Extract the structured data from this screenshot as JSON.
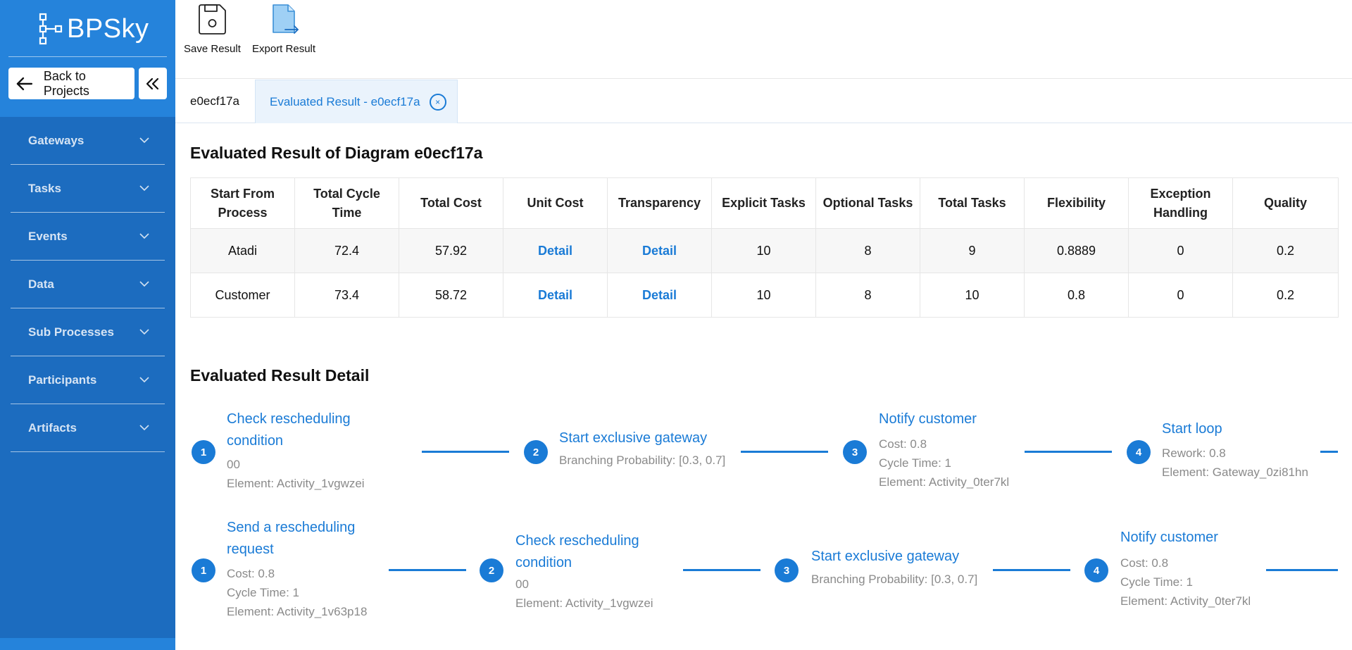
{
  "app": {
    "name": "BPSky"
  },
  "sidebar": {
    "back_label": "Back to Projects",
    "items": [
      {
        "label": "Gateways"
      },
      {
        "label": "Tasks"
      },
      {
        "label": "Events"
      },
      {
        "label": "Data"
      },
      {
        "label": "Sub Processes"
      },
      {
        "label": "Participants"
      },
      {
        "label": "Artifacts"
      }
    ]
  },
  "toolbar": {
    "save_label": "Save Result",
    "export_label": "Export Result"
  },
  "tabs": [
    {
      "label": "e0ecf17a",
      "active": false
    },
    {
      "label": "Evaluated Result - e0ecf17a",
      "active": true,
      "close": "×"
    }
  ],
  "main": {
    "title": "Evaluated Result of Diagram e0ecf17a",
    "detail_title": "Evaluated Result Detail"
  },
  "table": {
    "headers": [
      "Start From Process",
      "Total Cycle Time",
      "Total Cost",
      "Unit Cost",
      "Transparency",
      "Explicit Tasks",
      "Optional Tasks",
      "Total Tasks",
      "Flexibility",
      "Exception Handling",
      "Quality"
    ],
    "rows": [
      [
        "Atadi",
        "72.4",
        "57.92",
        "Detail",
        "Detail",
        "10",
        "8",
        "9",
        "0.8889",
        "0",
        "0.2"
      ],
      [
        "Customer",
        "73.4",
        "58.72",
        "Detail",
        "Detail",
        "10",
        "8",
        "10",
        "0.8",
        "0",
        "0.2"
      ]
    ]
  },
  "flows": [
    {
      "steps": [
        {
          "num": "1",
          "title_lines": [
            "Check rescheduling",
            "condition"
          ],
          "meta": [
            "00",
            "Element: Activity_1vgwzei"
          ]
        },
        {
          "num": "2",
          "title_lines": [
            "Start exclusive gateway"
          ],
          "meta": [
            "Branching Probability: [0.3, 0.7]"
          ]
        },
        {
          "num": "3",
          "title_lines": [
            "Notify customer"
          ],
          "meta": [
            "Cost: 0.8",
            "Cycle Time: 1",
            "Element: Activity_0ter7kl"
          ]
        },
        {
          "num": "4",
          "title_lines": [
            "Start loop"
          ],
          "meta": [
            "Rework: 0.8",
            "Element: Gateway_0zi81hn"
          ]
        }
      ]
    },
    {
      "steps": [
        {
          "num": "1",
          "title_lines": [
            "Send a rescheduling",
            "request"
          ],
          "meta": [
            "Cost: 0.8",
            "Cycle Time: 1",
            "Element: Activity_1v63p18"
          ]
        },
        {
          "num": "2",
          "title_lines": [
            "Check rescheduling",
            "condition"
          ],
          "meta": [
            "00",
            "Element: Activity_1vgwzei"
          ]
        },
        {
          "num": "3",
          "title_lines": [
            "Start exclusive gateway"
          ],
          "meta": [
            "Branching Probability: [0.3, 0.7]"
          ]
        },
        {
          "num": "4",
          "title_lines": [
            "Notify customer"
          ],
          "meta": [
            "Cost: 0.8",
            "Cycle Time: 1",
            "Element: Activity_0ter7kl"
          ]
        }
      ]
    }
  ]
}
